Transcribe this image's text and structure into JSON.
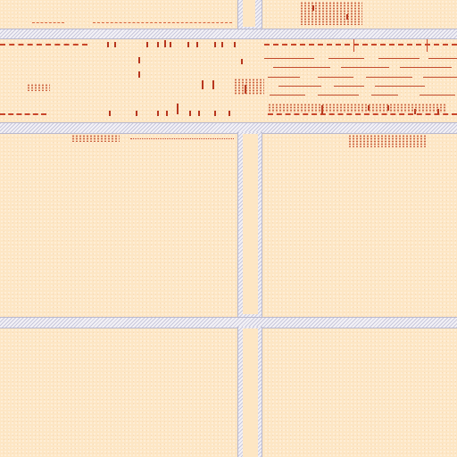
{
  "map": {
    "kind": "street-block tile",
    "colors": {
      "block_fill": "#fde6c4",
      "road_fill": "#f3f1f6",
      "road_edge": "#b9b9cf",
      "road_hatch": "#c8c8dc",
      "feature": "#c9462a"
    },
    "blocks": [
      "block-nw",
      "block-ne",
      "block-w-mid",
      "block-e-mid",
      "block-sw",
      "block-se"
    ],
    "roads": [
      "road-top-h",
      "road-mid-h",
      "road-low-h",
      "road-v-upper",
      "road-v-lower"
    ],
    "labels": []
  }
}
